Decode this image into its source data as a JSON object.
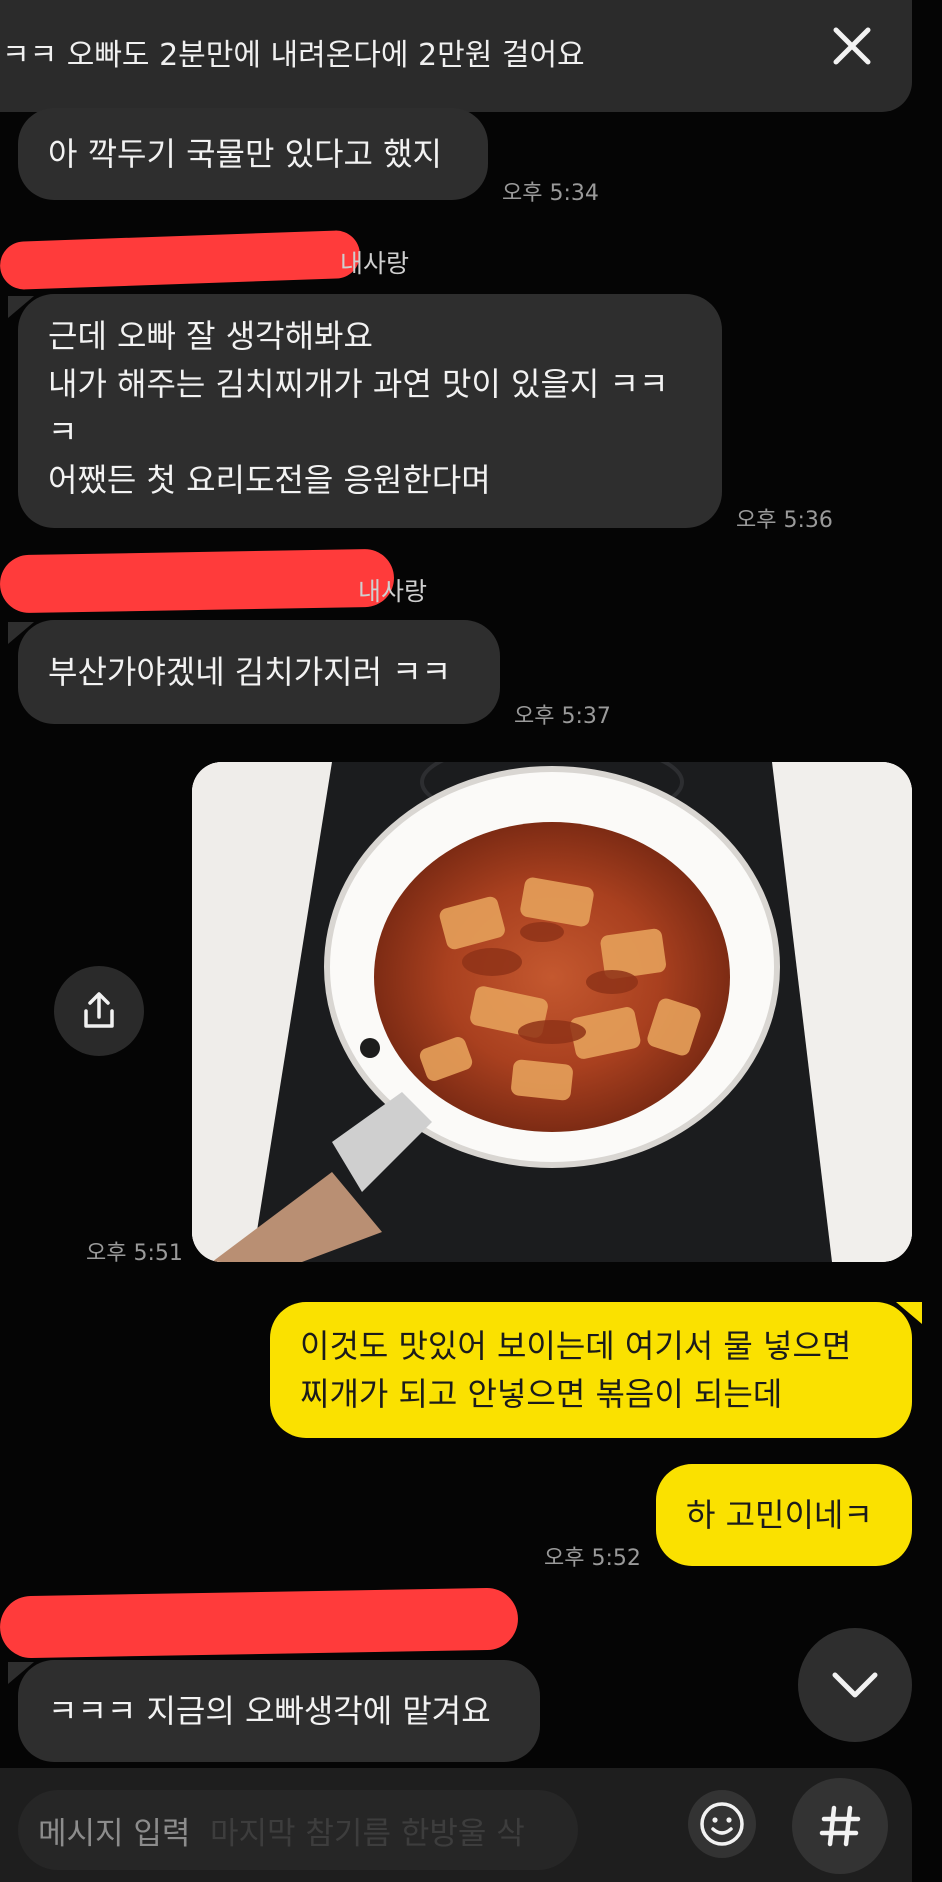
{
  "banner": {
    "text": "ㅋㅋ 오빠도 2분만에 내려온다에 2만원 걸어요",
    "close_icon": "close-icon"
  },
  "messages": [
    {
      "text": "아 깍두기 국물만 있다고 했지",
      "time": "오후 5:34"
    },
    {
      "sender": "내사랑",
      "lines": [
        "근데 오빠 잘 생각해봐요",
        "내가 해주는 김치찌개가 과연 맛이 있을지 ㅋㅋ",
        "ㅋ",
        "어쨌든 첫 요리도전을 응원한다며"
      ],
      "time": "오후 5:36"
    },
    {
      "sender": "내사랑",
      "text": "부산가야겠네 김치가지러 ㅋㅋ",
      "time": "오후 5:37"
    },
    {
      "type": "photo",
      "time": "오후 5:51",
      "share_icon": "share-icon"
    },
    {
      "mine": true,
      "lines": [
        "이것도 맛있어 보이는데 여기서 물 넣으면",
        "찌개가 되고 안넣으면 볶음이 되는데"
      ]
    },
    {
      "mine": true,
      "text": "하 고민이네ㅋ",
      "time": "오후 5:52"
    },
    {
      "text": "ㅋㅋㅋ 지금의 오빠생각에 맡겨요"
    }
  ],
  "input": {
    "placeholder": "메시지 입력",
    "ghost_text": "마지막 참기름 한방울 삭"
  },
  "colors": {
    "background": "#050505",
    "bubble_other": "#2e2e2e",
    "bubble_mine": "#fae100",
    "redaction": "#ff3b3b"
  }
}
